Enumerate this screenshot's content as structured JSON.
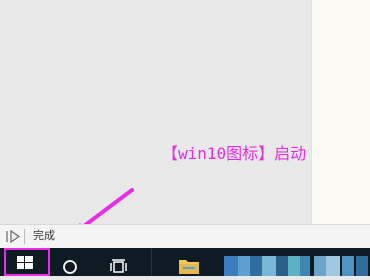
{
  "annotation": {
    "text": "【win10图标】启动",
    "color": "#e52ee5"
  },
  "statusbar": {
    "status_text": "完成"
  },
  "taskbar": {
    "background": "#0f1b22",
    "items": [
      {
        "name": "start-button",
        "icon": "windows-icon"
      },
      {
        "name": "search-button",
        "icon": "cortana-circle-icon"
      },
      {
        "name": "task-view-button",
        "icon": "task-view-icon"
      },
      {
        "name": "file-explorer-button",
        "icon": "folder-icon"
      }
    ],
    "highlight_color": "#e52ee5"
  }
}
